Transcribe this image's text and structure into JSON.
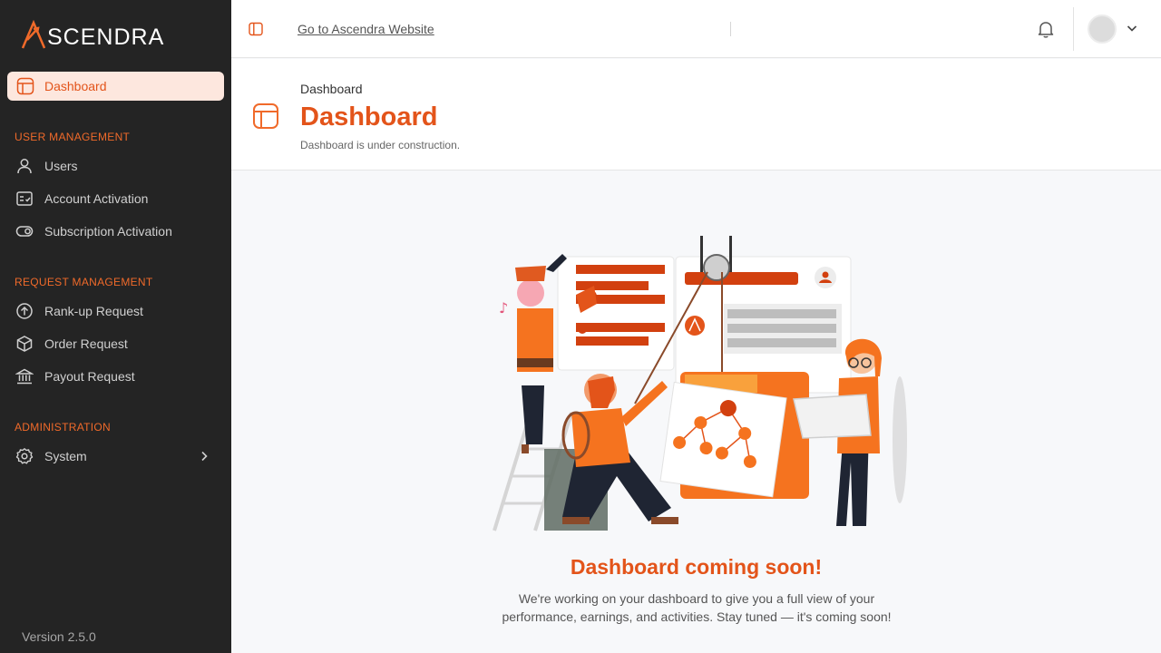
{
  "sidebar": {
    "logo_text": "SCENDRA",
    "active_item": {
      "label": "Dashboard",
      "icon": "dashboard-icon"
    },
    "sections": [
      {
        "title": "USER MANAGEMENT",
        "items": [
          {
            "label": "Users",
            "icon": "user-icon"
          },
          {
            "label": "Account Activation",
            "icon": "checklist-icon"
          },
          {
            "label": "Subscription Activation",
            "icon": "toggle-icon"
          }
        ]
      },
      {
        "title": "REQUEST MANAGEMENT",
        "items": [
          {
            "label": "Rank-up Request",
            "icon": "arrow-up-circle-icon"
          },
          {
            "label": "Order Request",
            "icon": "box-icon"
          },
          {
            "label": "Payout Request",
            "icon": "bank-icon"
          }
        ]
      },
      {
        "title": "ADMINISTRATION",
        "items": [
          {
            "label": "System",
            "icon": "gear-icon"
          }
        ]
      }
    ],
    "version": "Version 2.5.0"
  },
  "topbar": {
    "website_link": "Go to Ascendra Website"
  },
  "header": {
    "breadcrumb": "Dashboard",
    "title": "Dashboard",
    "subtitle": "Dashboard is under construction."
  },
  "main": {
    "title": "Dashboard coming soon!",
    "message": "We're working on your dashboard to give you a full view of your performance, earnings, and activities. Stay tuned — it's coming soon!"
  },
  "colors": {
    "accent": "#e3541a",
    "sidebar_bg": "#242424",
    "active_bg": "#fde7de"
  }
}
